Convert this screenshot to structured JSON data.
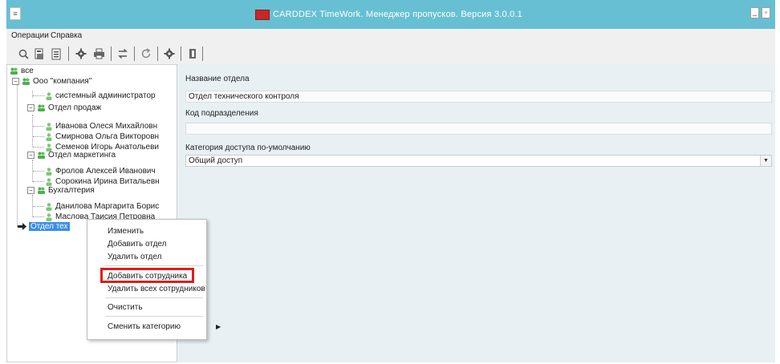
{
  "window": {
    "title": "CARDDEX TimeWork. Менеджер пропусков. Версия 3.0.0.1",
    "controls": {
      "minimize": "_",
      "restore": "▫"
    }
  },
  "menubar": {
    "items": [
      "Операции",
      "Справка"
    ]
  },
  "toolbar": {
    "buttons": [
      "search-icon",
      "pass-add-icon",
      "pass-edit-icon",
      "settings-icon",
      "print-icon",
      "transfer-icon",
      "refresh-icon",
      "gear-icon",
      "exit-icon"
    ]
  },
  "tree": {
    "root": "все",
    "company": "Ооо \"компания\"",
    "admin": "системный администратор",
    "departments": [
      {
        "name": "Отдел продаж",
        "employees": [
          "Иванова Олеся Михайловн",
          "Смирнова Ольга Викторовн",
          "Семенов Игорь Анатольеви"
        ]
      },
      {
        "name": "Отдел маркетинга",
        "employees": [
          "Фролов Алексей Иванович",
          "Сорокина Ирина Витальевн"
        ]
      },
      {
        "name": "Бухгалтерия",
        "employees": [
          "Данилова Маргарита Борис",
          "Маслова Таисия Петровна"
        ]
      }
    ],
    "selected": "Отдел тех"
  },
  "details": {
    "name_label": "Название отдела",
    "name_value": "Отдел технического контроля",
    "code_label": "Код подразделения",
    "code_value": "",
    "category_label": "Категория доступа по-умолчанию",
    "category_value": "Общий доступ"
  },
  "context_menu": {
    "edit": "Изменить",
    "add_department": "Добавить отдел",
    "delete_department": "Удалить отдел",
    "add_employee": "Добавить сотрудника",
    "delete_all_employees": "Удалить всех сотрудников",
    "clear": "Очистить",
    "change_category": "Сменить категорию",
    "submenu_arrow": "▶"
  },
  "colors": {
    "titlebar": "#67bfd3",
    "detail_bg": "#e8f0f4",
    "highlight_border": "#e01c1c",
    "selection": "#3a8ee6",
    "tree_group_icon": "#4caf50"
  }
}
